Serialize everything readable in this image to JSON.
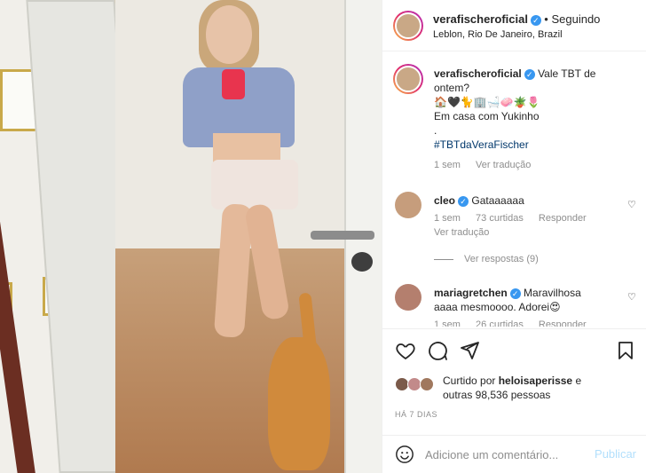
{
  "post": {
    "username": "verafischeroficial",
    "follow_status": "Seguindo",
    "location": "Leblon, Rio De Janeiro, Brazil",
    "caption": {
      "line1": "Vale TBT de",
      "line2": "ontem?",
      "emoji_line": "🏠🖤🐈🏢🛁🧼🪴🌷",
      "line3": "Em casa com Yukinho",
      "line4": ".",
      "hashtag": "#TBTdaVeraFischer",
      "time": "1 sem",
      "translate": "Ver tradução"
    }
  },
  "comments": [
    {
      "username": "cleo",
      "text": "Gataaaaaa",
      "time": "1 sem",
      "likes": "73 curtidas",
      "reply": "Responder",
      "translate": "Ver tradução",
      "view_replies": "Ver respostas (9)"
    },
    {
      "username": "mariagretchen",
      "text_line1": "Maravilhosa",
      "text_line2": "aaaa mesmoooo. Adorei😍",
      "time": "1 sem",
      "likes": "26 curtidas",
      "reply": "Responder"
    }
  ],
  "actions": {
    "liked_by_prefix": "Curtido por",
    "liked_by_user": "heloisaperisse",
    "liked_by_suffix": "e",
    "liked_by_others": "outras 98,536 pessoas",
    "date": "HÁ 7 DIAS"
  },
  "add_comment": {
    "placeholder": "Adicione um comentário...",
    "publish": "Publicar"
  },
  "colors": {
    "verified": "#3897f0",
    "link": "#00376b",
    "muted": "#8e8e8e",
    "publish_disabled": "#b2dffc"
  }
}
